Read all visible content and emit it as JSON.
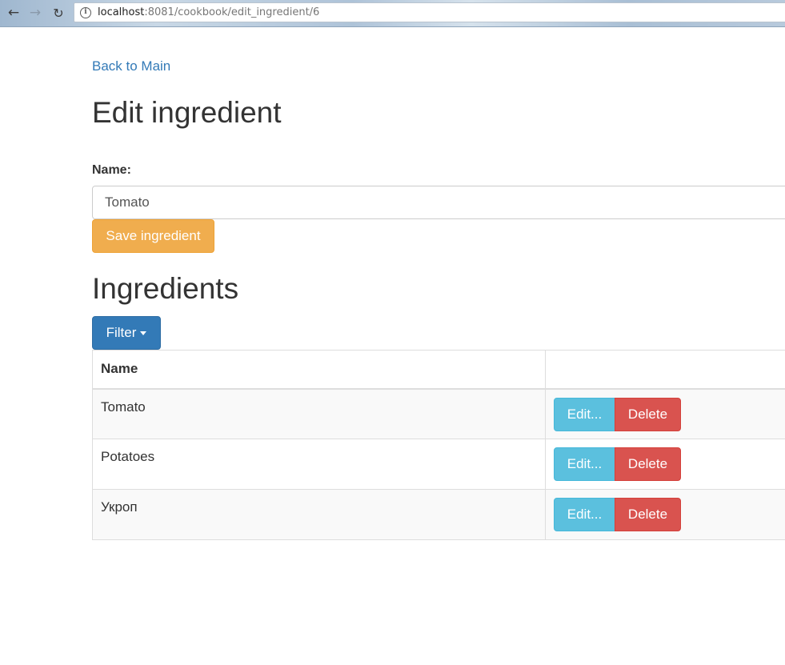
{
  "browser": {
    "url_host": "localhost",
    "url_rest": ":8081/cookbook/edit_ingredient/6",
    "back_icon": "←",
    "forward_icon": "→",
    "reload_icon": "↻",
    "info_icon": "i"
  },
  "page": {
    "back_link": "Back to Main",
    "title": "Edit ingredient",
    "name_label": "Name:",
    "name_value": "Tomato",
    "save_button": "Save ingredient",
    "section_title": "Ingredients",
    "filter_button": "Filter"
  },
  "table": {
    "headers": [
      "Name",
      ""
    ],
    "rows": [
      {
        "name": "Tomato",
        "edit": "Edit...",
        "delete": "Delete"
      },
      {
        "name": "Potatoes",
        "edit": "Edit...",
        "delete": "Delete"
      },
      {
        "name": "Укроп",
        "edit": "Edit...",
        "delete": "Delete"
      }
    ]
  },
  "colors": {
    "link": "#337ab7",
    "warning": "#f0ad4e",
    "primary": "#337ab7",
    "info": "#5bc0de",
    "danger": "#d9534f"
  }
}
